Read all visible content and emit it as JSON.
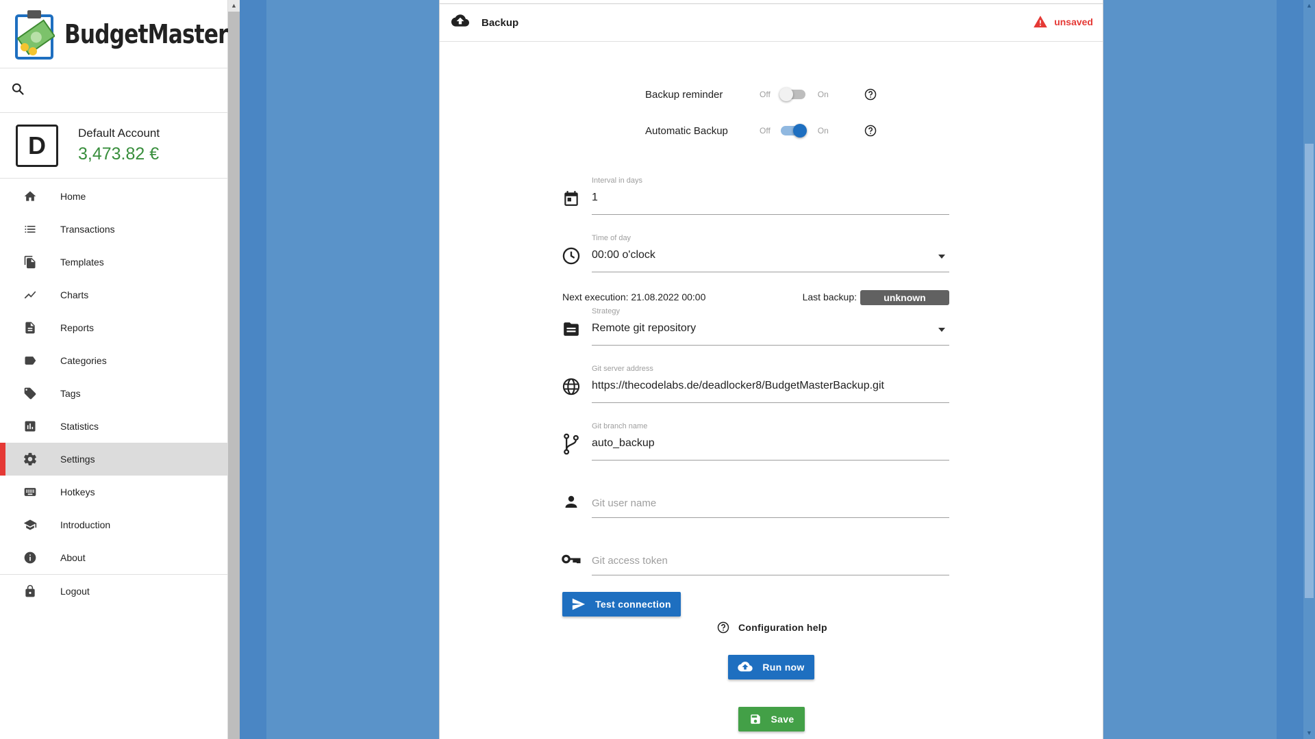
{
  "app": {
    "name": "BudgetMaster"
  },
  "search": {
    "icon": "search-icon"
  },
  "account": {
    "initial": "D",
    "name": "Default Account",
    "balance": "3,473.82 €",
    "balance_color": "#388e3c"
  },
  "nav": {
    "items": [
      {
        "label": "Home",
        "icon": "home-icon"
      },
      {
        "label": "Transactions",
        "icon": "list-icon"
      },
      {
        "label": "Templates",
        "icon": "file-copy-icon"
      },
      {
        "label": "Charts",
        "icon": "show-chart-icon"
      },
      {
        "label": "Reports",
        "icon": "description-icon"
      },
      {
        "label": "Categories",
        "icon": "label-icon"
      },
      {
        "label": "Tags",
        "icon": "tag-icon"
      },
      {
        "label": "Statistics",
        "icon": "bar-chart-icon"
      },
      {
        "label": "Settings",
        "icon": "settings-icon",
        "active": true
      },
      {
        "label": "Hotkeys",
        "icon": "keyboard-icon"
      },
      {
        "label": "Introduction",
        "icon": "school-icon"
      },
      {
        "label": "About",
        "icon": "info-icon"
      },
      {
        "label": "Logout",
        "icon": "lock-icon"
      }
    ],
    "accent_color": "#e53935"
  },
  "card": {
    "title": "Backup",
    "status": "unsaved",
    "status_color": "#e53935"
  },
  "backup_reminder": {
    "label": "Backup reminder",
    "off": "Off",
    "on": "On",
    "enabled": false
  },
  "automatic_backup": {
    "label": "Automatic Backup",
    "off": "Off",
    "on": "On",
    "enabled": true
  },
  "interval": {
    "label": "Interval in days",
    "value": "1"
  },
  "time_of_day": {
    "label": "Time of day",
    "value": "00:00 o'clock"
  },
  "next_execution": "Next execution: 21.08.2022 00:00",
  "last_backup": {
    "label": "Last backup:",
    "value": "unknown"
  },
  "strategy": {
    "label": "Strategy",
    "value": "Remote git repository"
  },
  "git_server": {
    "label": "Git server address",
    "value": "https://thecodelabs.de/deadlocker8/BudgetMasterBackup.git"
  },
  "git_branch": {
    "label": "Git branch name",
    "value": "auto_backup"
  },
  "git_user": {
    "placeholder": "Git user name"
  },
  "git_token": {
    "placeholder": "Git access token"
  },
  "buttons": {
    "test_connection": "Test connection",
    "config_help": "Configuration help",
    "run_now": "Run now",
    "save": "Save"
  },
  "colors": {
    "primary": "#1e6fc0",
    "success": "#43a047",
    "background": "#5a93c9"
  }
}
